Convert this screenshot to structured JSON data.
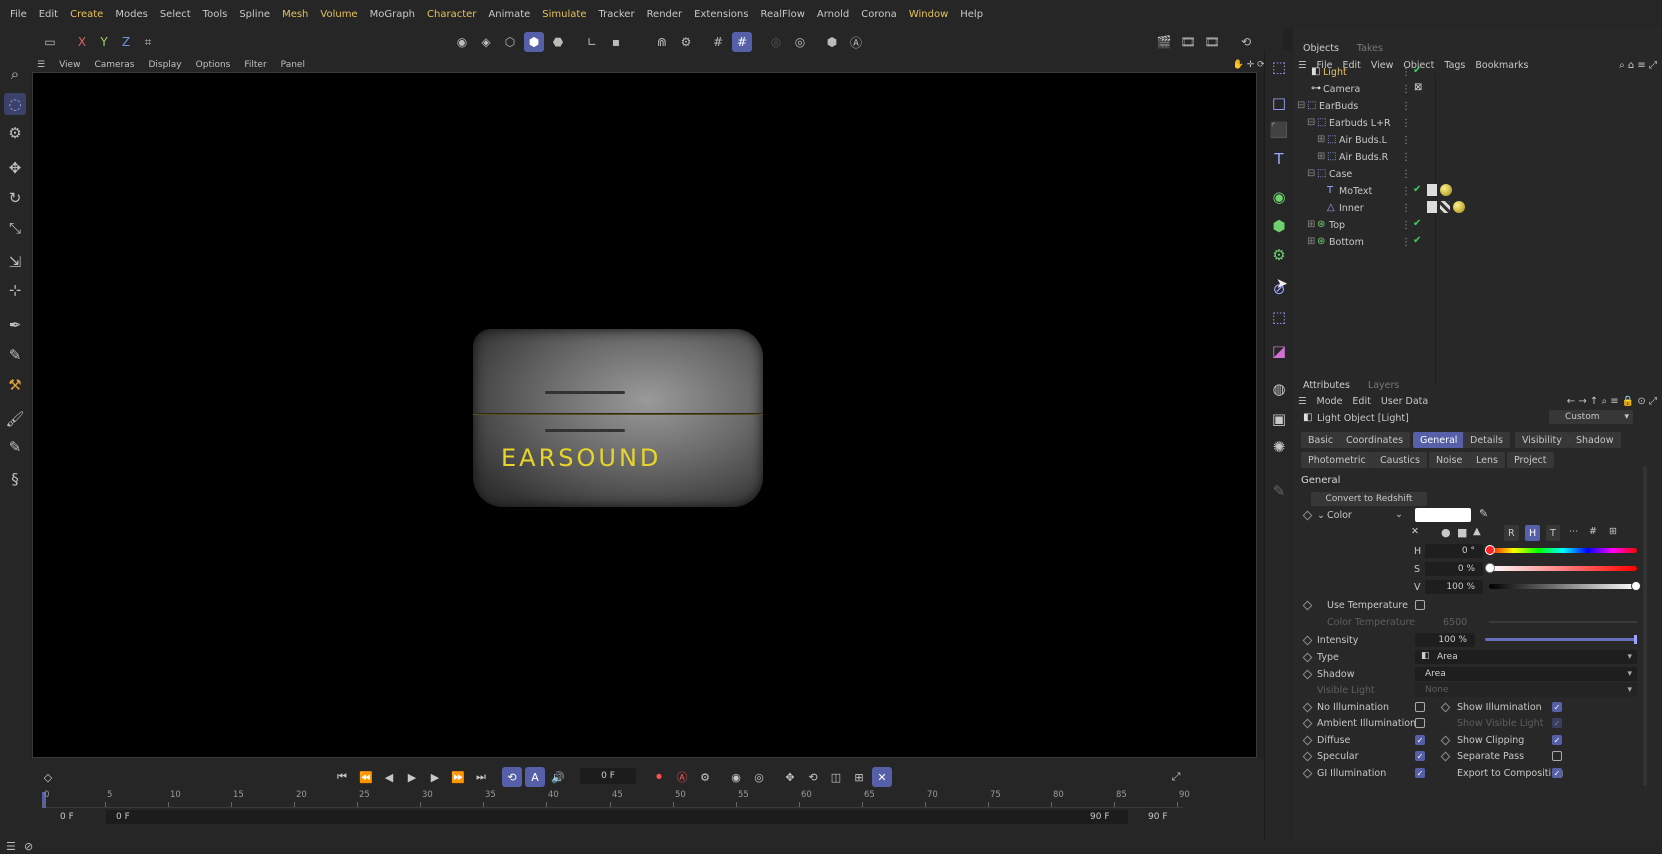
{
  "menu": [
    "File",
    "Edit",
    "Create",
    "Modes",
    "Select",
    "Tools",
    "Spline",
    "Mesh",
    "Volume",
    "MoGraph",
    "Character",
    "Animate",
    "Simulate",
    "Tracker",
    "Render",
    "Extensions",
    "RealFlow",
    "Arnold",
    "Corona",
    "Window",
    "Help"
  ],
  "toolbar": {
    "x": "X",
    "y": "Y",
    "z": "Z"
  },
  "viewport_menu": [
    "View",
    "Cameras",
    "Display",
    "Options",
    "Filter",
    "Panel"
  ],
  "viewport": {
    "product_text": "EARSOUND",
    "text_color": "#e8d52a"
  },
  "timeline": {
    "frame_field": "0 F",
    "ticks": [
      "0",
      "5",
      "10",
      "15",
      "20",
      "25",
      "30",
      "35",
      "40",
      "45",
      "50",
      "55",
      "60",
      "65",
      "70",
      "75",
      "80",
      "85",
      "90"
    ],
    "start_a": "0 F",
    "start_b": "0 F",
    "end_a": "90 F",
    "end_b": "90 F"
  },
  "objects": {
    "tabs": [
      "Objects",
      "Takes"
    ],
    "menu": [
      "File",
      "Edit",
      "View",
      "Object",
      "Tags",
      "Bookmarks"
    ],
    "rows": [
      {
        "name": "Light",
        "selected": true
      },
      {
        "name": "Camera"
      },
      {
        "name": "EarBuds"
      },
      {
        "name": "Earbuds L+R"
      },
      {
        "name": "Air Buds.L"
      },
      {
        "name": "Air Buds.R"
      },
      {
        "name": "Case"
      },
      {
        "name": "MoText"
      },
      {
        "name": "Inner"
      },
      {
        "name": "Top"
      },
      {
        "name": "Bottom"
      }
    ]
  },
  "attributes": {
    "tabs": [
      "Attributes",
      "Layers"
    ],
    "menu": [
      "Mode",
      "Edit",
      "User Data"
    ],
    "object_title": "Light Object [Light]",
    "preset": "Custom",
    "tabs_row1": [
      "Basic",
      "Coordinates",
      "General",
      "Details",
      "Visibility",
      "Shadow"
    ],
    "tabs_row2": [
      "Photometric",
      "Caustics",
      "Noise",
      "Lens",
      "Project"
    ],
    "section": "General",
    "convert_button": "Convert to Redshift",
    "color_label": "Color",
    "color_modes": [
      "R",
      "H",
      "T"
    ],
    "hsv": [
      {
        "label": "H",
        "value": "0 °"
      },
      {
        "label": "S",
        "value": "0 %"
      },
      {
        "label": "V",
        "value": "100 %"
      }
    ],
    "use_temperature": "Use Temperature",
    "color_temperature": {
      "label": "Color Temperature",
      "value": "6500"
    },
    "intensity": {
      "label": "Intensity",
      "value": "100 %"
    },
    "type": {
      "label": "Type",
      "value": "Area"
    },
    "shadow": {
      "label": "Shadow",
      "value": "Area"
    },
    "visible_light": {
      "label": "Visible Light",
      "value": "None"
    },
    "checks_left": [
      {
        "label": "No Illumination",
        "checked": false
      },
      {
        "label": "Ambient Illumination",
        "checked": false
      },
      {
        "label": "Diffuse",
        "checked": true
      },
      {
        "label": "Specular",
        "checked": true
      },
      {
        "label": "GI Illumination",
        "checked": true
      }
    ],
    "checks_right": [
      {
        "label": "Show Illumination",
        "checked": true
      },
      {
        "label": "Show Visible Light",
        "checked": true
      },
      {
        "label": "Show Clipping",
        "checked": true
      },
      {
        "label": "Separate Pass",
        "checked": false
      },
      {
        "label": "Export to Compositing",
        "checked": true
      }
    ]
  },
  "colors": {
    "accent": "#5660a8",
    "highlight": "#e6c25a",
    "check": "#3ecf5a"
  }
}
